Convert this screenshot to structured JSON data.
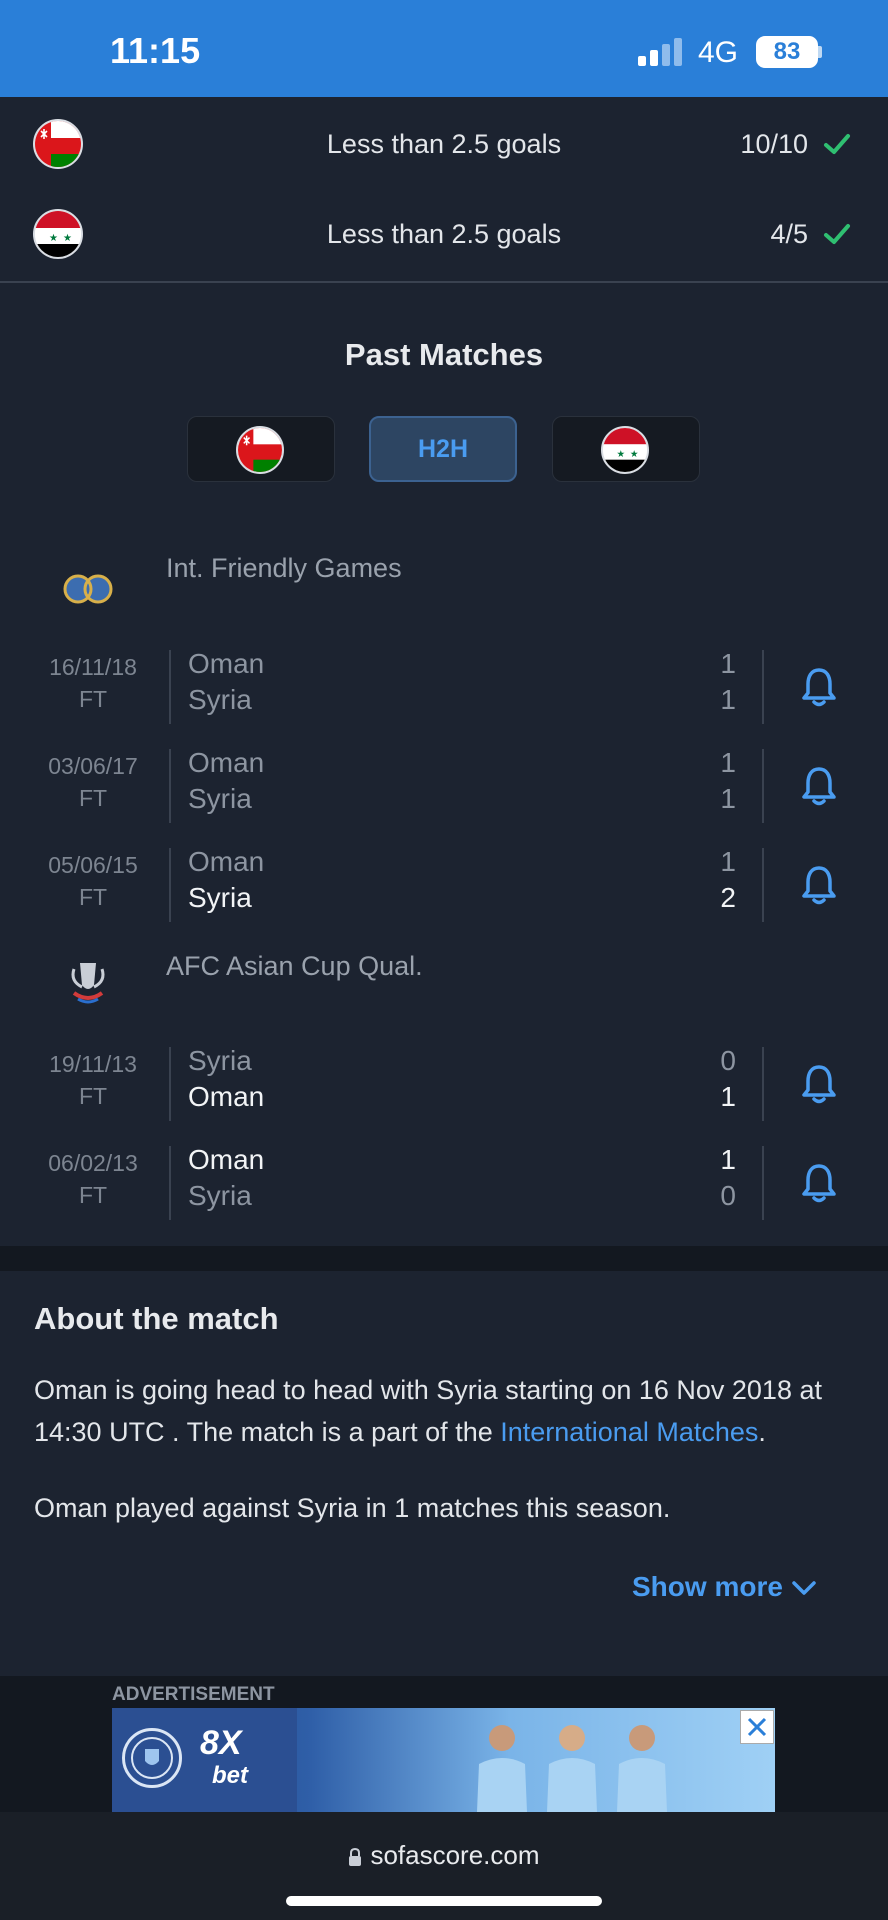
{
  "status_bar": {
    "time": "11:15",
    "network": "4G",
    "battery": "83"
  },
  "trends": [
    {
      "team": "Oman",
      "text": "Less than 2.5 goals",
      "count": "10/10"
    },
    {
      "team": "Syria",
      "text": "Less than 2.5 goals",
      "count": "4/5"
    }
  ],
  "past_matches": {
    "title": "Past Matches",
    "tabs": {
      "h2h_label": "H2H"
    },
    "leagues": [
      {
        "name": "Int. Friendly Games"
      },
      {
        "name": "AFC Asian Cup Qual."
      }
    ],
    "matches": [
      {
        "date": "16/11/18",
        "status": "FT",
        "home": "Oman",
        "away": "Syria",
        "home_score": "1",
        "away_score": "1"
      },
      {
        "date": "03/06/17",
        "status": "FT",
        "home": "Oman",
        "away": "Syria",
        "home_score": "1",
        "away_score": "1"
      },
      {
        "date": "05/06/15",
        "status": "FT",
        "home": "Oman",
        "away": "Syria",
        "home_score": "1",
        "away_score": "2"
      },
      {
        "date": "19/11/13",
        "status": "FT",
        "home": "Syria",
        "away": "Oman",
        "home_score": "0",
        "away_score": "1"
      },
      {
        "date": "06/02/13",
        "status": "FT",
        "home": "Oman",
        "away": "Syria",
        "home_score": "1",
        "away_score": "0"
      }
    ]
  },
  "about": {
    "title": "About the match",
    "p1_text": "Oman is going head to head with Syria starting on 16 Nov 2018 at 14:30 UTC . The match is a part of the ",
    "p1_link": "International Matches",
    "p1_end": ".",
    "p2": "Oman played against Syria in 1 matches this season.",
    "show_more": "Show more"
  },
  "ad": {
    "label": "ADVERTISEMENT",
    "brand": "8X",
    "brand_sub": "bet"
  },
  "browser": {
    "url": "sofascore.com"
  },
  "colors": {
    "accent": "#4a9cf0",
    "status_bar": "#2a7fd8",
    "background": "#1c2330",
    "check": "#2fbf71"
  }
}
